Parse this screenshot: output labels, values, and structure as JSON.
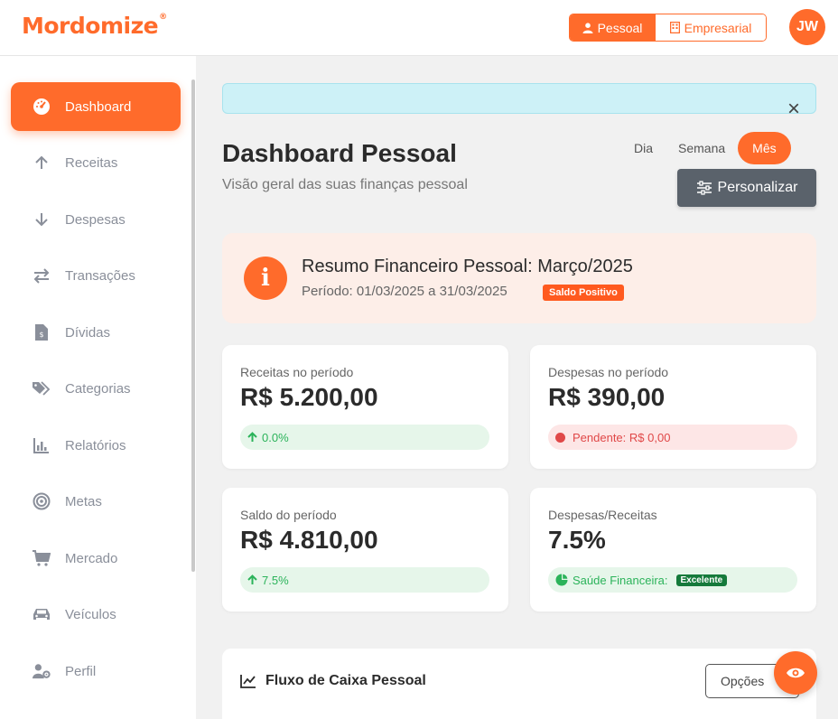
{
  "app": {
    "logo": "Mordomize",
    "logo_mark": "®",
    "mode_personal": "Pessoal",
    "mode_business": "Empresarial",
    "avatar_initials": "JW",
    "brand_color": "#ff6b2b"
  },
  "sidebar": {
    "items": [
      {
        "label": "Dashboard",
        "icon": "dashboard-gauge-icon",
        "active": true
      },
      {
        "label": "Receitas",
        "icon": "arrow-up-icon"
      },
      {
        "label": "Despesas",
        "icon": "arrow-down-icon"
      },
      {
        "label": "Transações",
        "icon": "exchange-icon"
      },
      {
        "label": "Dívidas",
        "icon": "invoice-dollar-icon"
      },
      {
        "label": "Categorias",
        "icon": "tags-icon"
      },
      {
        "label": "Relatórios",
        "icon": "bar-chart-icon"
      },
      {
        "label": "Metas",
        "icon": "target-icon"
      },
      {
        "label": "Mercado",
        "icon": "cart-icon"
      },
      {
        "label": "Veículos",
        "icon": "car-icon"
      },
      {
        "label": "Perfil",
        "icon": "user-cog-icon"
      }
    ]
  },
  "main": {
    "title": "Dashboard Pessoal",
    "subtitle": "Visão geral das suas finanças pessoal",
    "period_tabs": [
      "Dia",
      "Semana",
      "Mês"
    ],
    "customize_label": "Personalizar",
    "summary": {
      "title": "Resumo Financeiro Pessoal: Março/2025",
      "period": "Período: 01/03/2025 a 31/03/2025",
      "badge": "Saldo Positivo"
    },
    "cards": {
      "income": {
        "label": "Receitas no período",
        "value": "R$ 5.200,00",
        "change": "0.0%"
      },
      "expenses": {
        "label": "Despesas no período",
        "value": "R$ 390,00",
        "pending": "Pendente: R$ 0,00"
      },
      "balance": {
        "label": "Saldo do período",
        "value": "R$ 4.810,00",
        "change": "7.5%"
      },
      "ratio": {
        "label": "Despesas/Receitas",
        "value": "7.5%",
        "health_label": "Saúde Financeira:",
        "health_badge": "Excelente"
      }
    },
    "cashflow": {
      "title": "Fluxo de Caixa Pessoal",
      "options_label": "Opções"
    }
  }
}
